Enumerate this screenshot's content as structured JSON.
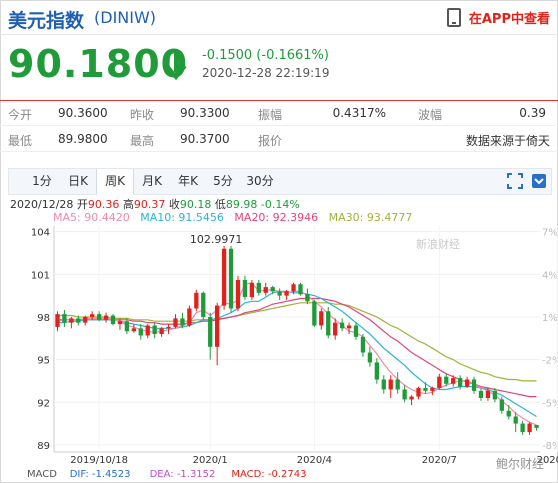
{
  "header": {
    "title": "美元指数",
    "code": "(DINIW)",
    "app_label": "在APP中查看"
  },
  "price": {
    "current": "90.1800",
    "change": "-0.1500 (-0.1661%)",
    "datetime": "2020-12-28 22:19:19"
  },
  "quote": {
    "open_label": "今开",
    "open": "90.3600",
    "prev_label": "昨收",
    "prev": "90.3300",
    "amp_label": "振幅",
    "amp": "0.4317%",
    "wave_label": "波幅",
    "wave": "0.39",
    "low_label": "最低",
    "low": "89.9800",
    "high_label": "最高",
    "high": "90.3700",
    "quote_label": "报价",
    "source": "数据来源于倚天"
  },
  "tabs": [
    "1分",
    "日K",
    "周K",
    "月K",
    "年K",
    "5分",
    "30分"
  ],
  "active_tab": 2,
  "ohlc_info": {
    "date": "2020/12/28",
    "open_label": "开",
    "open": "90.36",
    "high_label": "高",
    "high": "90.37",
    "close_label": "收",
    "close": "90.18",
    "low_label": "低",
    "low": "89.98",
    "pct": "-0.14%"
  },
  "ma_info": {
    "ma5": "MA5: 90.4420",
    "ma10": "MA10: 91.5456",
    "ma20": "MA20: 92.3946",
    "ma30": "MA30: 93.4777"
  },
  "macd": {
    "label": "MACD",
    "dif": "DIF: -1.4523",
    "dea": "DEA: -1.3152",
    "macd": "MACD: -0.2743"
  },
  "watermark_brand": "新浪财经",
  "corner_mark": "鲍尔财经",
  "colors": {
    "up": "#1f9b3a",
    "down": "#e0231a",
    "ma5": "#f08aa8",
    "ma10": "#2bb3d8",
    "ma20": "#e0467a",
    "ma30": "#9fb33a",
    "link": "#1f5fb4"
  },
  "chart_data": {
    "type": "candlestick",
    "y_ticks": [
      "104",
      "101",
      "98",
      "95",
      "92",
      "89"
    ],
    "right_ticks": [
      "7%",
      "4%",
      "1%",
      "-2%",
      "-5%",
      "-8%"
    ],
    "x_ticks": [
      "2019/10/18",
      "2020/1",
      "2020/4",
      "2020/7",
      "2020/10",
      "2020/12"
    ],
    "ylim": [
      88.5,
      104.4
    ],
    "peak_label": "102.9971",
    "candles": [
      {
        "o": 97.3,
        "h": 98.4,
        "l": 97.0,
        "c": 98.2
      },
      {
        "o": 98.2,
        "h": 98.5,
        "l": 97.3,
        "c": 97.6
      },
      {
        "o": 97.6,
        "h": 98.0,
        "l": 97.2,
        "c": 97.9
      },
      {
        "o": 97.9,
        "h": 98.1,
        "l": 97.4,
        "c": 97.6
      },
      {
        "o": 97.6,
        "h": 98.1,
        "l": 97.4,
        "c": 98.0
      },
      {
        "o": 98.0,
        "h": 98.4,
        "l": 97.8,
        "c": 98.2
      },
      {
        "o": 98.2,
        "h": 98.4,
        "l": 97.7,
        "c": 97.8
      },
      {
        "o": 97.8,
        "h": 98.3,
        "l": 97.6,
        "c": 98.1
      },
      {
        "o": 98.1,
        "h": 98.2,
        "l": 97.4,
        "c": 97.5
      },
      {
        "o": 97.5,
        "h": 97.9,
        "l": 97.1,
        "c": 97.7
      },
      {
        "o": 97.7,
        "h": 97.9,
        "l": 96.8,
        "c": 97.0
      },
      {
        "o": 97.0,
        "h": 97.5,
        "l": 96.9,
        "c": 97.2
      },
      {
        "o": 97.2,
        "h": 97.5,
        "l": 96.4,
        "c": 96.7
      },
      {
        "o": 96.7,
        "h": 97.5,
        "l": 96.5,
        "c": 97.4
      },
      {
        "o": 97.4,
        "h": 97.6,
        "l": 96.5,
        "c": 96.8
      },
      {
        "o": 96.8,
        "h": 97.3,
        "l": 96.6,
        "c": 97.2
      },
      {
        "o": 97.2,
        "h": 97.5,
        "l": 96.8,
        "c": 97.3
      },
      {
        "o": 97.3,
        "h": 98.2,
        "l": 97.2,
        "c": 97.9
      },
      {
        "o": 97.9,
        "h": 98.3,
        "l": 97.2,
        "c": 97.4
      },
      {
        "o": 97.4,
        "h": 98.8,
        "l": 97.3,
        "c": 98.6
      },
      {
        "o": 98.6,
        "h": 99.9,
        "l": 98.4,
        "c": 99.7
      },
      {
        "o": 99.7,
        "h": 99.8,
        "l": 97.8,
        "c": 98.0
      },
      {
        "o": 98.0,
        "h": 98.3,
        "l": 95.0,
        "c": 95.9
      },
      {
        "o": 95.9,
        "h": 99.0,
        "l": 94.6,
        "c": 98.8
      },
      {
        "o": 98.8,
        "h": 103.0,
        "l": 98.5,
        "c": 102.8
      },
      {
        "o": 102.8,
        "h": 103.0,
        "l": 98.3,
        "c": 98.6
      },
      {
        "o": 98.6,
        "h": 100.9,
        "l": 98.4,
        "c": 100.6
      },
      {
        "o": 100.6,
        "h": 100.9,
        "l": 99.2,
        "c": 99.4
      },
      {
        "o": 99.4,
        "h": 100.6,
        "l": 99.2,
        "c": 100.4
      },
      {
        "o": 100.4,
        "h": 100.6,
        "l": 99.5,
        "c": 99.7
      },
      {
        "o": 99.7,
        "h": 100.4,
        "l": 99.5,
        "c": 100.1
      },
      {
        "o": 100.1,
        "h": 100.2,
        "l": 99.6,
        "c": 99.8
      },
      {
        "o": 99.8,
        "h": 100.0,
        "l": 99.2,
        "c": 99.5
      },
      {
        "o": 99.5,
        "h": 99.9,
        "l": 99.2,
        "c": 99.8
      },
      {
        "o": 99.8,
        "h": 100.4,
        "l": 99.6,
        "c": 100.3
      },
      {
        "o": 100.3,
        "h": 100.4,
        "l": 99.5,
        "c": 99.6
      },
      {
        "o": 99.6,
        "h": 100.0,
        "l": 98.9,
        "c": 99.1
      },
      {
        "o": 99.1,
        "h": 99.2,
        "l": 97.3,
        "c": 97.4
      },
      {
        "o": 97.4,
        "h": 98.6,
        "l": 97.1,
        "c": 98.4
      },
      {
        "o": 98.4,
        "h": 98.7,
        "l": 96.5,
        "c": 96.7
      },
      {
        "o": 96.7,
        "h": 97.9,
        "l": 96.4,
        "c": 97.6
      },
      {
        "o": 97.6,
        "h": 97.9,
        "l": 97.0,
        "c": 97.2
      },
      {
        "o": 97.2,
        "h": 97.6,
        "l": 96.8,
        "c": 97.4
      },
      {
        "o": 97.4,
        "h": 97.6,
        "l": 96.4,
        "c": 96.6
      },
      {
        "o": 96.6,
        "h": 96.8,
        "l": 95.2,
        "c": 95.5
      },
      {
        "o": 95.5,
        "h": 95.9,
        "l": 94.5,
        "c": 94.8
      },
      {
        "o": 94.8,
        "h": 95.1,
        "l": 93.3,
        "c": 93.6
      },
      {
        "o": 93.6,
        "h": 93.9,
        "l": 92.6,
        "c": 92.9
      },
      {
        "o": 92.9,
        "h": 93.9,
        "l": 92.3,
        "c": 93.6
      },
      {
        "o": 93.6,
        "h": 94.1,
        "l": 92.6,
        "c": 92.9
      },
      {
        "o": 92.9,
        "h": 93.2,
        "l": 92.0,
        "c": 92.2
      },
      {
        "o": 92.2,
        "h": 92.5,
        "l": 91.8,
        "c": 92.4
      },
      {
        "o": 92.4,
        "h": 93.1,
        "l": 92.2,
        "c": 93.0
      },
      {
        "o": 93.0,
        "h": 93.4,
        "l": 92.6,
        "c": 92.8
      },
      {
        "o": 92.8,
        "h": 93.1,
        "l": 92.5,
        "c": 93.0
      },
      {
        "o": 93.0,
        "h": 94.0,
        "l": 92.9,
        "c": 93.8
      },
      {
        "o": 93.8,
        "h": 94.0,
        "l": 93.1,
        "c": 93.3
      },
      {
        "o": 93.3,
        "h": 93.9,
        "l": 93.1,
        "c": 93.7
      },
      {
        "o": 93.7,
        "h": 93.9,
        "l": 92.9,
        "c": 93.1
      },
      {
        "o": 93.1,
        "h": 93.8,
        "l": 93.0,
        "c": 93.6
      },
      {
        "o": 93.6,
        "h": 93.8,
        "l": 92.6,
        "c": 92.8
      },
      {
        "o": 92.8,
        "h": 93.0,
        "l": 92.1,
        "c": 92.3
      },
      {
        "o": 92.3,
        "h": 93.0,
        "l": 92.1,
        "c": 92.8
      },
      {
        "o": 92.8,
        "h": 93.0,
        "l": 92.0,
        "c": 92.2
      },
      {
        "o": 92.2,
        "h": 92.4,
        "l": 91.2,
        "c": 91.4
      },
      {
        "o": 91.4,
        "h": 91.8,
        "l": 90.8,
        "c": 91.0
      },
      {
        "o": 91.0,
        "h": 91.3,
        "l": 89.9,
        "c": 90.5
      },
      {
        "o": 90.5,
        "h": 90.7,
        "l": 89.7,
        "c": 89.9
      },
      {
        "o": 89.9,
        "h": 90.6,
        "l": 89.7,
        "c": 90.5
      },
      {
        "o": 90.4,
        "h": 90.4,
        "l": 90.0,
        "c": 90.2
      }
    ],
    "ma5": [
      97.7,
      97.8,
      97.8,
      97.8,
      97.9,
      97.9,
      97.9,
      97.9,
      97.8,
      97.7,
      97.4,
      97.3,
      97.1,
      97.0,
      96.9,
      97.0,
      97.1,
      97.2,
      97.4,
      97.6,
      98.3,
      98.5,
      98.1,
      98.5,
      99.0,
      98.9,
      99.2,
      100.3,
      100.4,
      99.8,
      99.9,
      99.9,
      99.8,
      99.7,
      99.8,
      99.8,
      99.5,
      99.1,
      98.7,
      98.2,
      97.8,
      97.4,
      97.0,
      96.9,
      96.6,
      96.0,
      95.4,
      94.7,
      94.1,
      93.6,
      93.2,
      92.9,
      92.7,
      92.6,
      92.7,
      93.0,
      93.2,
      93.4,
      93.5,
      93.5,
      93.3,
      93.0,
      92.8,
      92.5,
      92.1,
      91.7,
      91.2,
      90.9,
      90.6,
      90.4
    ],
    "ma10": [
      97.6,
      97.6,
      97.7,
      97.7,
      97.8,
      97.8,
      97.8,
      97.8,
      97.8,
      97.7,
      97.6,
      97.5,
      97.4,
      97.3,
      97.2,
      97.2,
      97.2,
      97.2,
      97.3,
      97.4,
      97.6,
      97.8,
      97.8,
      97.9,
      98.1,
      98.3,
      98.6,
      99.0,
      99.1,
      99.1,
      99.4,
      99.7,
      99.8,
      99.8,
      99.7,
      99.7,
      99.6,
      99.5,
      99.3,
      99.0,
      98.7,
      98.4,
      98.0,
      97.6,
      97.2,
      96.8,
      96.3,
      95.8,
      95.4,
      95.0,
      94.6,
      94.1,
      93.7,
      93.3,
      93.0,
      92.9,
      92.9,
      93.0,
      93.1,
      93.1,
      93.1,
      93.0,
      92.9,
      92.7,
      92.5,
      92.2,
      91.9,
      91.6,
      91.3,
      91.0
    ],
    "ma20": [
      97.8,
      97.8,
      97.8,
      97.8,
      97.8,
      97.8,
      97.8,
      97.8,
      97.8,
      97.8,
      97.8,
      97.7,
      97.7,
      97.6,
      97.6,
      97.5,
      97.5,
      97.5,
      97.5,
      97.6,
      97.6,
      97.7,
      97.7,
      97.8,
      97.9,
      98.0,
      98.1,
      98.3,
      98.4,
      98.5,
      98.7,
      98.9,
      99.0,
      99.1,
      99.2,
      99.3,
      99.3,
      99.3,
      99.3,
      99.2,
      99.1,
      98.9,
      98.7,
      98.4,
      98.1,
      97.8,
      97.4,
      97.0,
      96.6,
      96.3,
      95.9,
      95.5,
      95.2,
      94.9,
      94.6,
      94.3,
      94.0,
      93.8,
      93.6,
      93.4,
      93.3,
      93.1,
      93.0,
      92.9,
      92.8,
      92.7,
      92.6,
      92.5,
      92.4,
      92.4
    ],
    "ma30": [
      98.1,
      98.1,
      98.1,
      98.0,
      98.0,
      98.0,
      98.0,
      98.0,
      97.9,
      97.9,
      97.9,
      97.8,
      97.8,
      97.8,
      97.7,
      97.7,
      97.7,
      97.7,
      97.7,
      97.7,
      97.8,
      97.8,
      97.8,
      97.9,
      97.9,
      98.0,
      98.1,
      98.2,
      98.3,
      98.4,
      98.5,
      98.6,
      98.7,
      98.8,
      98.9,
      99.0,
      99.0,
      99.0,
      99.0,
      99.0,
      98.9,
      98.9,
      98.8,
      98.6,
      98.4,
      98.2,
      98.0,
      97.7,
      97.4,
      97.2,
      96.9,
      96.6,
      96.3,
      96.1,
      95.8,
      95.5,
      95.2,
      95.0,
      94.7,
      94.5,
      94.3,
      94.1,
      94.0,
      93.8,
      93.7,
      93.6,
      93.6,
      93.5,
      93.5,
      93.5
    ]
  }
}
